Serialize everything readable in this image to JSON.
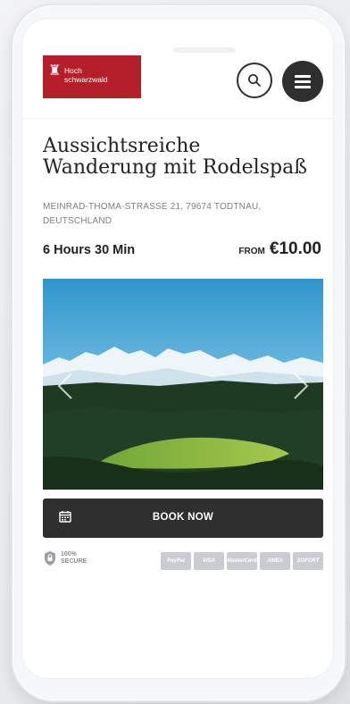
{
  "header": {
    "logo_line1": "Hoch",
    "logo_line2": "schwarzwald",
    "search_icon": "search-icon",
    "menu_icon": "hamburger-menu-icon"
  },
  "tour": {
    "title_line1": "Aussichtsreiche",
    "title_line2": "Wanderung mit Rodelspaß",
    "address_line1": "MEINRAD-THOMA-STRASSE 21, 79674 TODTNAU,",
    "address_line2": "DEUTSCHLAND",
    "duration": "6 Hours 30 Min",
    "price_prefix": "FROM",
    "price": "€10.00"
  },
  "gallery": {
    "prev_icon": "chevron-left-icon",
    "next_icon": "chevron-right-icon"
  },
  "booking": {
    "button_label": "BOOK NOW",
    "icon": "calendar-icon"
  },
  "footer": {
    "secure_line1": "100%",
    "secure_line2": "SECURE",
    "payment_methods": [
      "PayPal",
      "VISA",
      "MasterCard",
      "AMEX",
      "SOFORT"
    ]
  },
  "colors": {
    "brand_red": "#b3202a",
    "dark": "#2f2f2f"
  }
}
